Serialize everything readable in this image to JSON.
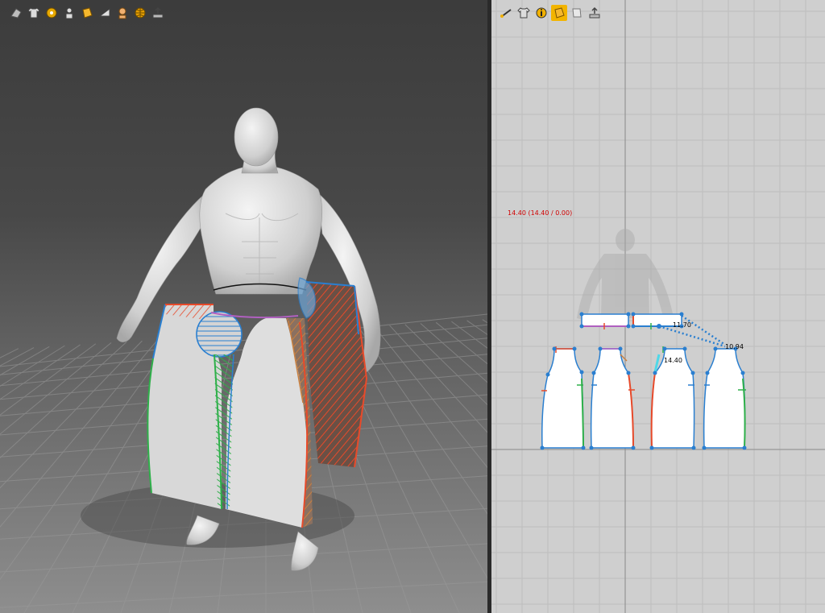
{
  "toolbar_3d": {
    "buttons": [
      {
        "icon": "arrange-icon"
      },
      {
        "icon": "shirt-icon"
      },
      {
        "icon": "simulate-icon"
      },
      {
        "icon": "avatar-icon"
      },
      {
        "icon": "texture-icon"
      },
      {
        "icon": "flatten-icon"
      },
      {
        "icon": "skin-icon"
      },
      {
        "icon": "globe-icon"
      },
      {
        "icon": "export-icon"
      }
    ]
  },
  "toolbar_2d": {
    "buttons": [
      {
        "icon": "segment-icon"
      },
      {
        "icon": "shirt-icon"
      },
      {
        "icon": "info-icon"
      },
      {
        "icon": "texture-icon",
        "active": true
      },
      {
        "icon": "fold-icon"
      },
      {
        "icon": "export-icon"
      }
    ]
  },
  "pattern_view": {
    "readout": "14.40 (14.40 / 0.00)",
    "measurements": {
      "waistband_length": "11.70",
      "diagonal_length": "10.94",
      "piece_length": "14.40"
    }
  },
  "colors": {
    "active_tool": "#f2b400",
    "seam_blue": "#2a7fd0",
    "seam_red": "#e84a2a",
    "seam_green": "#2fb04a",
    "seam_purple": "#b060c0",
    "readout_red": "#d00000"
  }
}
